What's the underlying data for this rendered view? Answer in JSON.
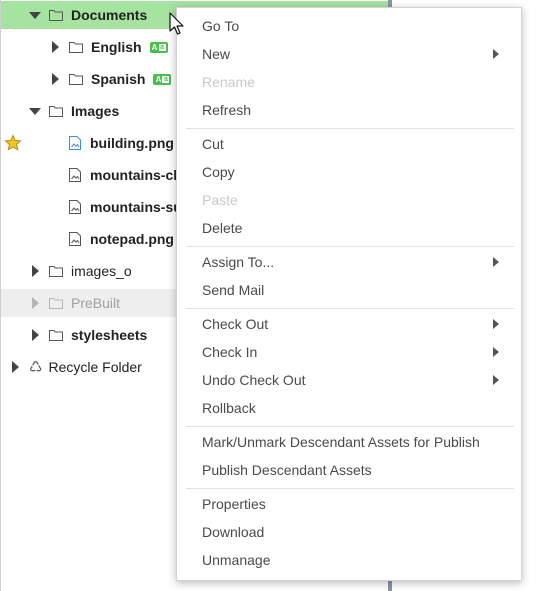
{
  "tree": {
    "nodes": [
      {
        "label": "Documents",
        "bold": true
      },
      {
        "label": "English",
        "bold": true,
        "badge": true
      },
      {
        "label": "Spanish",
        "bold": true,
        "badge": true
      },
      {
        "label": "Images",
        "bold": true
      },
      {
        "label": "building.png",
        "bold": true,
        "starred": true
      },
      {
        "label": "mountains-clo",
        "bold": true
      },
      {
        "label": "mountains-su",
        "bold": true
      },
      {
        "label": "notepad.png",
        "bold": true
      },
      {
        "label": "images_o",
        "bold": false
      },
      {
        "label": "PreBuilt",
        "bold": false,
        "dim": true
      },
      {
        "label": "stylesheets",
        "bold": true
      },
      {
        "label": "Recycle Folder",
        "bold": false
      }
    ]
  },
  "context_menu": {
    "items": [
      {
        "label": "Go To"
      },
      {
        "label": "New",
        "submenu": true
      },
      {
        "label": "Rename",
        "disabled": true
      },
      {
        "label": "Refresh"
      },
      {
        "label": "Cut"
      },
      {
        "label": "Copy"
      },
      {
        "label": "Paste",
        "disabled": true
      },
      {
        "label": "Delete"
      },
      {
        "label": "Assign To...",
        "submenu": true
      },
      {
        "label": "Send Mail"
      },
      {
        "label": "Check Out",
        "submenu": true
      },
      {
        "label": "Check In",
        "submenu": true
      },
      {
        "label": "Undo Check Out",
        "submenu": true
      },
      {
        "label": "Rollback"
      },
      {
        "label": "Mark/Unmark Descendant Assets for Publish"
      },
      {
        "label": "Publish Descendant Assets"
      },
      {
        "label": "Properties"
      },
      {
        "label": "Download"
      },
      {
        "label": "Unmanage"
      }
    ]
  },
  "colors": {
    "selected_row": "#a6e3a0",
    "language_badge": "#45c14a",
    "star": "#f3c623"
  }
}
